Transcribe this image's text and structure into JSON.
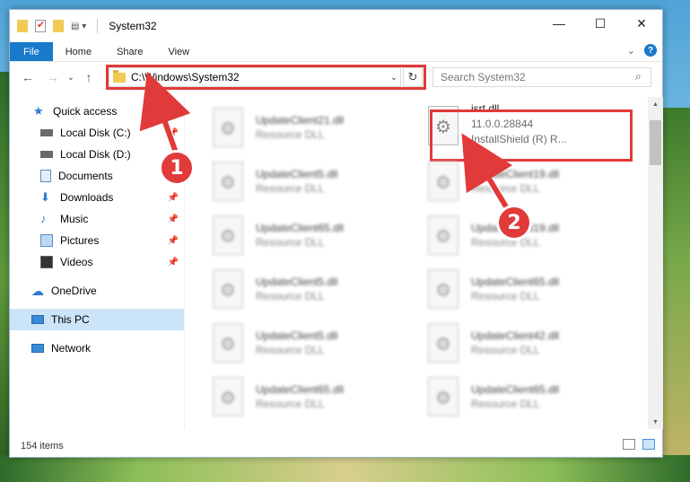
{
  "window": {
    "title": "System32",
    "controls": {
      "minimize": "—",
      "maximize": "☐",
      "close": "✕"
    }
  },
  "ribbon": {
    "tabs": [
      "File",
      "Home",
      "Share",
      "View"
    ],
    "expand": "⌄",
    "help": "?"
  },
  "address": {
    "path": "C:\\Windows\\System32",
    "dropdown": "⌄",
    "refresh": "↻"
  },
  "search": {
    "placeholder": "Search System32",
    "icon": "⌕"
  },
  "nav": {
    "back": "←",
    "forward": "→",
    "recent": "⌄",
    "up": "↑",
    "items": [
      {
        "label": "Quick access",
        "icon": "star-icon"
      },
      {
        "label": "Local Disk (C:)",
        "icon": "drive-icon"
      },
      {
        "label": "Local Disk (D:)",
        "icon": "drive-icon"
      },
      {
        "label": "Documents",
        "icon": "documents-icon"
      },
      {
        "label": "Downloads",
        "icon": "download-icon"
      },
      {
        "label": "Music",
        "icon": "music-icon"
      },
      {
        "label": "Pictures",
        "icon": "pictures-icon"
      },
      {
        "label": "Videos",
        "icon": "videos-icon"
      },
      {
        "label": "OneDrive",
        "icon": "cloud-icon"
      },
      {
        "label": "This PC",
        "icon": "computer-icon"
      },
      {
        "label": "Network",
        "icon": "network-icon"
      }
    ]
  },
  "files": {
    "left": [
      {
        "name": "UpdateClient21.dll",
        "type": "Resource DLL"
      },
      {
        "name": "UpdateClient5.dll",
        "type": "Resource DLL"
      },
      {
        "name": "UpdateClient65.dll",
        "type": "Resource DLL"
      },
      {
        "name": "UpdateClient5.dll",
        "type": "Resource DLL"
      },
      {
        "name": "UpdateClient5.dll",
        "type": "Resource DLL"
      },
      {
        "name": "UpdateClient65.dll",
        "type": "Resource DLL"
      }
    ],
    "right": [
      {
        "name": "isrt.dll",
        "version": "11.0.0.28844",
        "type": "InstallShield (R) R..."
      },
      {
        "name": "UpdateClient19.dll",
        "type": "Resource DLL"
      },
      {
        "name": "UpdateClient19.dll",
        "type": "Resource DLL"
      },
      {
        "name": "UpdateClient65.dll",
        "type": "Resource DLL"
      },
      {
        "name": "UpdateClient42.dll",
        "type": "Resource DLL"
      },
      {
        "name": "UpdateClient65.dll",
        "type": "Resource DLL"
      }
    ]
  },
  "status": {
    "count": "154 items"
  },
  "annotations": {
    "one": "1",
    "two": "2"
  },
  "colors": {
    "accent": "#1979ca",
    "highlight": "#e13a3a",
    "selected": "#cce4f7"
  }
}
